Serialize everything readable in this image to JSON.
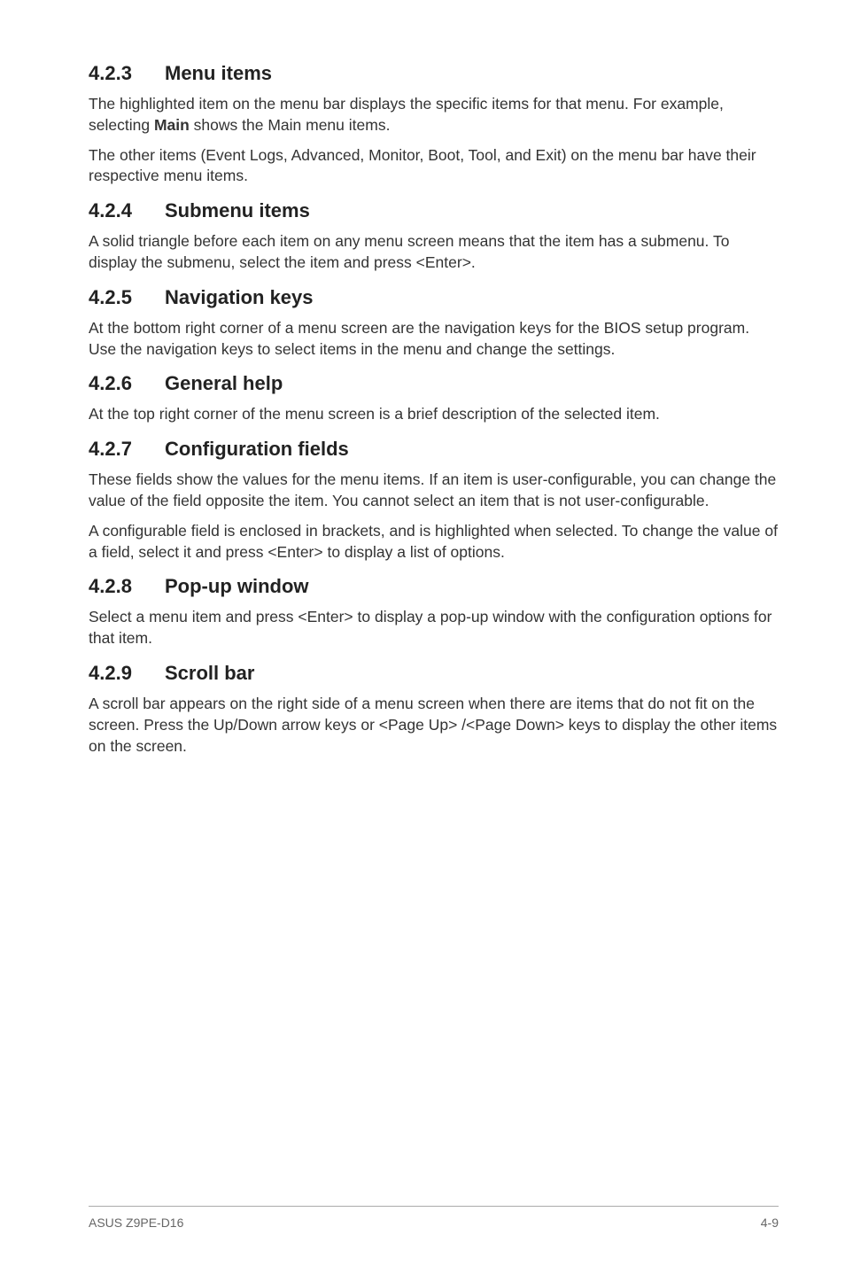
{
  "sections": [
    {
      "num": "4.2.3",
      "title": "Menu items",
      "paras": [
        {
          "segments": [
            {
              "t": "The highlighted item on the menu bar displays the specific items for that menu. For example, selecting "
            },
            {
              "t": "Main",
              "bold": true
            },
            {
              "t": " shows the Main menu items."
            }
          ]
        },
        {
          "segments": [
            {
              "t": "The other items (Event Logs, Advanced, Monitor, Boot, Tool, and Exit) on the menu bar have their respective menu items."
            }
          ]
        }
      ]
    },
    {
      "num": "4.2.4",
      "title": "Submenu items",
      "paras": [
        {
          "segments": [
            {
              "t": "A solid triangle before each item on any menu screen means that the item has a submenu. To display the submenu, select the item and press <Enter>."
            }
          ]
        }
      ]
    },
    {
      "num": "4.2.5",
      "title": "Navigation keys",
      "paras": [
        {
          "segments": [
            {
              "t": "At the bottom right corner of a menu screen are the navigation keys for the BIOS setup program. Use the navigation keys to select items in the menu and change the settings."
            }
          ]
        }
      ]
    },
    {
      "num": "4.2.6",
      "title": "General help",
      "paras": [
        {
          "segments": [
            {
              "t": "At the top right corner of the menu screen is a brief description of the selected item."
            }
          ]
        }
      ]
    },
    {
      "num": "4.2.7",
      "title": "Configuration fields",
      "paras": [
        {
          "segments": [
            {
              "t": "These fields show the values for the menu items. If an item is user-configurable, you can change the value of the field opposite the item. You cannot select an item that is not user-configurable."
            }
          ]
        },
        {
          "segments": [
            {
              "t": "A configurable field is enclosed in brackets, and is highlighted when selected. To change the value of a field, select it and press <Enter> to display a list of options."
            }
          ]
        }
      ]
    },
    {
      "num": "4.2.8",
      "title": "Pop-up window",
      "paras": [
        {
          "segments": [
            {
              "t": "Select a menu item and press <Enter> to display a pop-up window with the configuration options for that item."
            }
          ]
        }
      ]
    },
    {
      "num": "4.2.9",
      "title": "Scroll bar",
      "paras": [
        {
          "segments": [
            {
              "t": "A scroll bar appears on the right side of a menu screen when there are items that do not fit on the screen. Press the Up/Down arrow keys or <Page Up> /<Page Down> keys to display the other items on the screen."
            }
          ]
        }
      ]
    }
  ],
  "footer": {
    "left": "ASUS Z9PE-D16",
    "right": "4-9"
  }
}
